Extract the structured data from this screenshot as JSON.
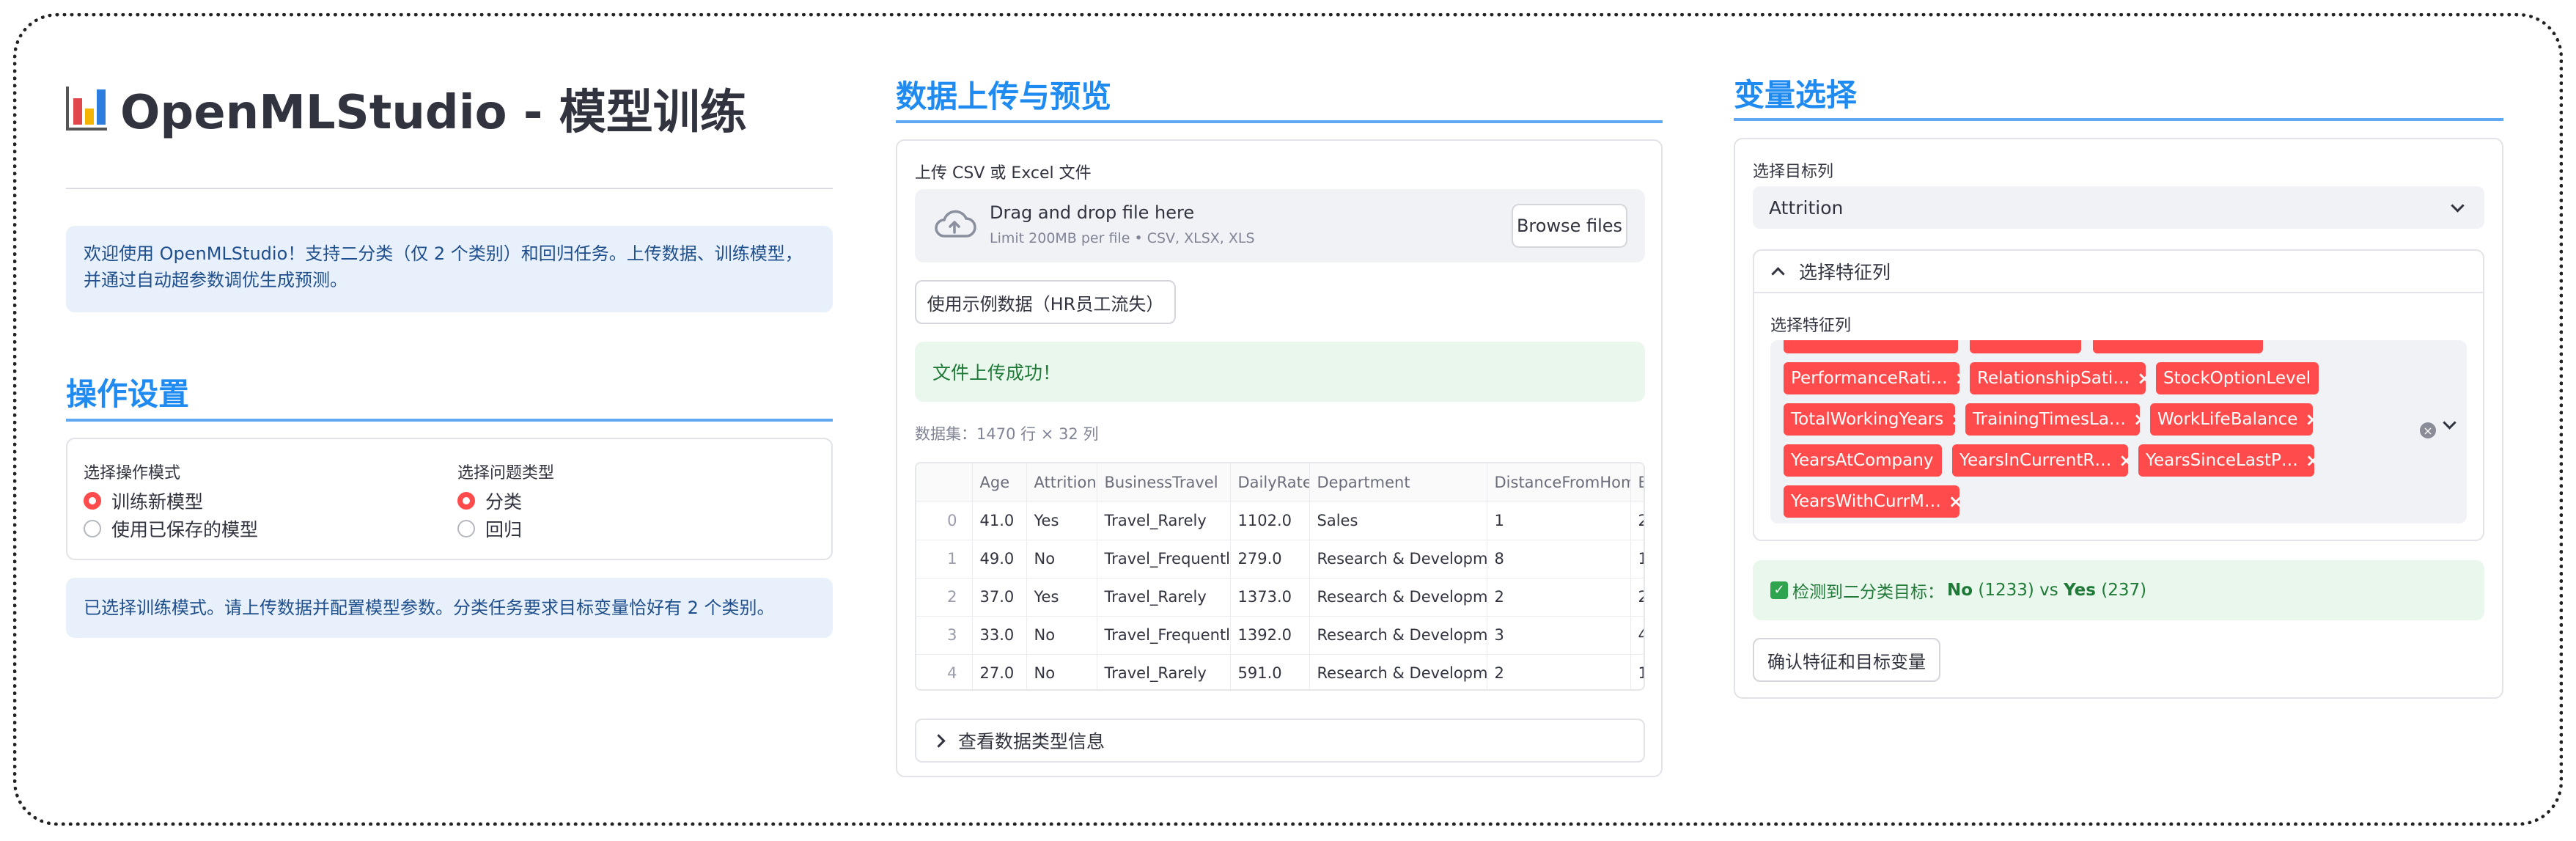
{
  "app": {
    "title": "OpenMLStudio - 模型训练",
    "welcome": "欢迎使用 OpenMLStudio！支持二分类（仅 2 个类别）和回归任务。上传数据、训练模型，并通过自动超参数调优生成预测。"
  },
  "settings": {
    "title": "操作设置",
    "mode_label": "选择操作模式",
    "mode_options": [
      "训练新模型",
      "使用已保存的模型"
    ],
    "mode_selected": "训练新模型",
    "type_label": "选择问题类型",
    "type_options": [
      "分类",
      "回归"
    ],
    "type_selected": "分类",
    "info": "已选择训练模式。请上传数据并配置模型参数。分类任务要求目标变量恰好有 2 个类别。"
  },
  "upload": {
    "title": "数据上传与预览",
    "uploader_label": "上传 CSV 或 Excel 文件",
    "drag_text": "Drag and drop file here",
    "limit_text": "Limit 200MB per file • CSV, XLSX, XLS",
    "browse_label": "Browse files",
    "sample_button": "使用示例数据（HR员工流失）",
    "success": "文件上传成功！",
    "dataset_caption_prefix": "数据集：",
    "dataset_caption_value": "1470 行 × 32 列",
    "table": {
      "columns": [
        "",
        "Age",
        "Attrition",
        "BusinessTravel",
        "DailyRate",
        "Department",
        "DistanceFromHome",
        "E"
      ],
      "rows": [
        [
          "0",
          "41.0",
          "Yes",
          "Travel_Rarely",
          "1102.0",
          "Sales",
          "1",
          "2"
        ],
        [
          "1",
          "49.0",
          "No",
          "Travel_Frequently",
          "279.0",
          "Research & Development",
          "8",
          "1"
        ],
        [
          "2",
          "37.0",
          "Yes",
          "Travel_Rarely",
          "1373.0",
          "Research & Development",
          "2",
          "2"
        ],
        [
          "3",
          "33.0",
          "No",
          "Travel_Frequently",
          "1392.0",
          "Research & Development",
          "3",
          "4"
        ],
        [
          "4",
          "27.0",
          "No",
          "Travel_Rarely",
          "591.0",
          "Research & Development",
          "2",
          "1"
        ]
      ]
    },
    "dtype_expander": "查看数据类型信息"
  },
  "variables": {
    "title": "变量选择",
    "target_label": "选择目标列",
    "target_value": "Attrition",
    "feature_expander": "选择特征列",
    "feature_label": "选择特征列",
    "tags": [
      "PerformanceRati…",
      "RelationshipSati…",
      "StockOptionLevel",
      "TotalWorkingYears",
      "TrainingTimesLa…",
      "WorkLifeBalance",
      "YearsAtCompany",
      "YearsInCurrentR…",
      "YearsSinceLastP…",
      "YearsWithCurrM…"
    ],
    "detect": {
      "prefix": "检测到二分类目标：",
      "class1": "No",
      "count1": "(1233)",
      "vs": "vs",
      "class2": "Yes",
      "count2": "(237)"
    },
    "confirm_button": "确认特征和目标变量"
  },
  "colors": {
    "accent_red": "#ff4b4b",
    "title_blue": "#1f8bf0",
    "info_bg": "#e8f1fb",
    "success_bg": "#e9f7ec"
  }
}
